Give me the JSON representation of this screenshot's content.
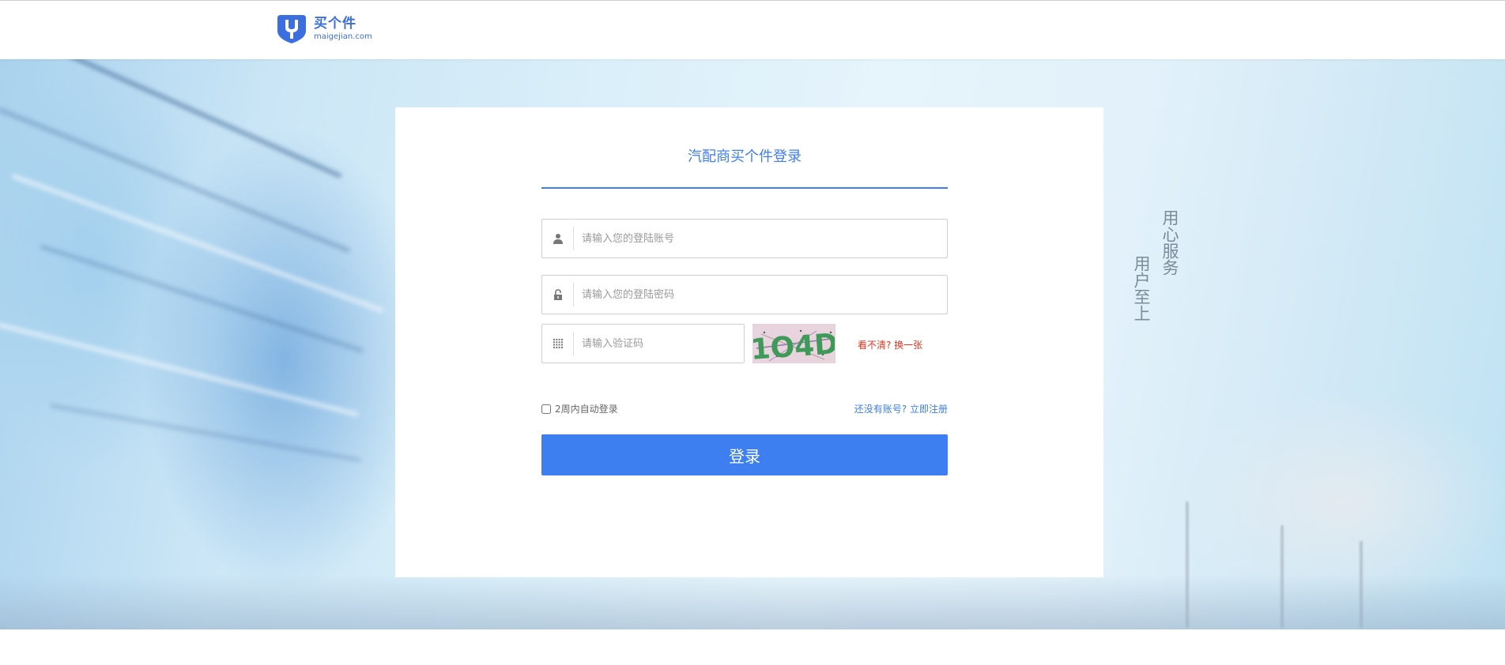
{
  "brand": {
    "name": "买个件",
    "domain": "maigejian.com",
    "accent": "#3d7ef0"
  },
  "hero": {
    "slogan": [
      "用心服务",
      "用户至上"
    ]
  },
  "login": {
    "title": "汽配商买个件登录",
    "account_placeholder": "请输入您的登陆账号",
    "password_placeholder": "请输入您的登陆密码",
    "captcha_placeholder": "请输入验证码",
    "captcha_text": "1O4D",
    "refresh_text": "看不清? 换一张",
    "remember_label": "2周内自动登录",
    "register_prompt": "还没有账号? ",
    "register_link": "立即注册",
    "submit_label": "登录",
    "icons": {
      "account": "user-icon",
      "password": "lock-icon",
      "captcha": "grid-icon"
    },
    "refresh_color": "#e0341e"
  }
}
